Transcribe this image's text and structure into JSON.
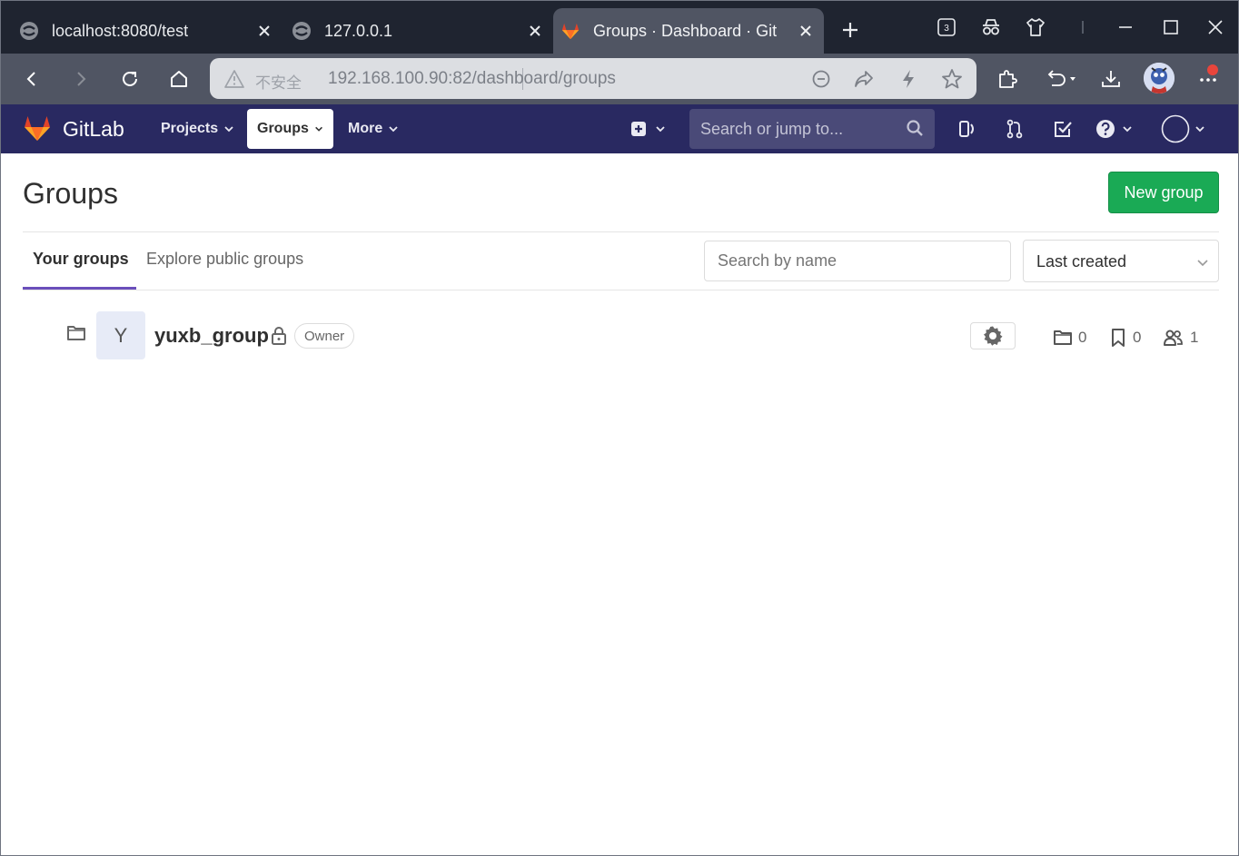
{
  "browser": {
    "tabs": [
      {
        "title": "localhost:8080/test",
        "active": false
      },
      {
        "title": "127.0.0.1",
        "active": false
      },
      {
        "title": "Groups · Dashboard · Git",
        "active": true
      }
    ],
    "tab_count_badge": "3",
    "insecure_label": "不安全",
    "url": "192.168.100.90:82/dashboard/groups"
  },
  "gitlab": {
    "brand": "GitLab",
    "nav": {
      "projects": "Projects",
      "groups": "Groups",
      "more": "More"
    },
    "search_placeholder": "Search or jump to..."
  },
  "page": {
    "title": "Groups",
    "new_group_label": "New group",
    "tabs": {
      "your_groups": "Your groups",
      "explore": "Explore public groups"
    },
    "filter_placeholder": "Search by name",
    "sort_selected": "Last created"
  },
  "groups": [
    {
      "avatar_letter": "Y",
      "name": "yuxb_group",
      "role": "Owner",
      "subgroups": "0",
      "projects": "0",
      "members": "1"
    }
  ],
  "colors": {
    "gitlab_header": "#292961",
    "primary_button": "#1aaa55",
    "tab_underline": "#6b4fbb",
    "notification_dot": "#e8453c"
  }
}
